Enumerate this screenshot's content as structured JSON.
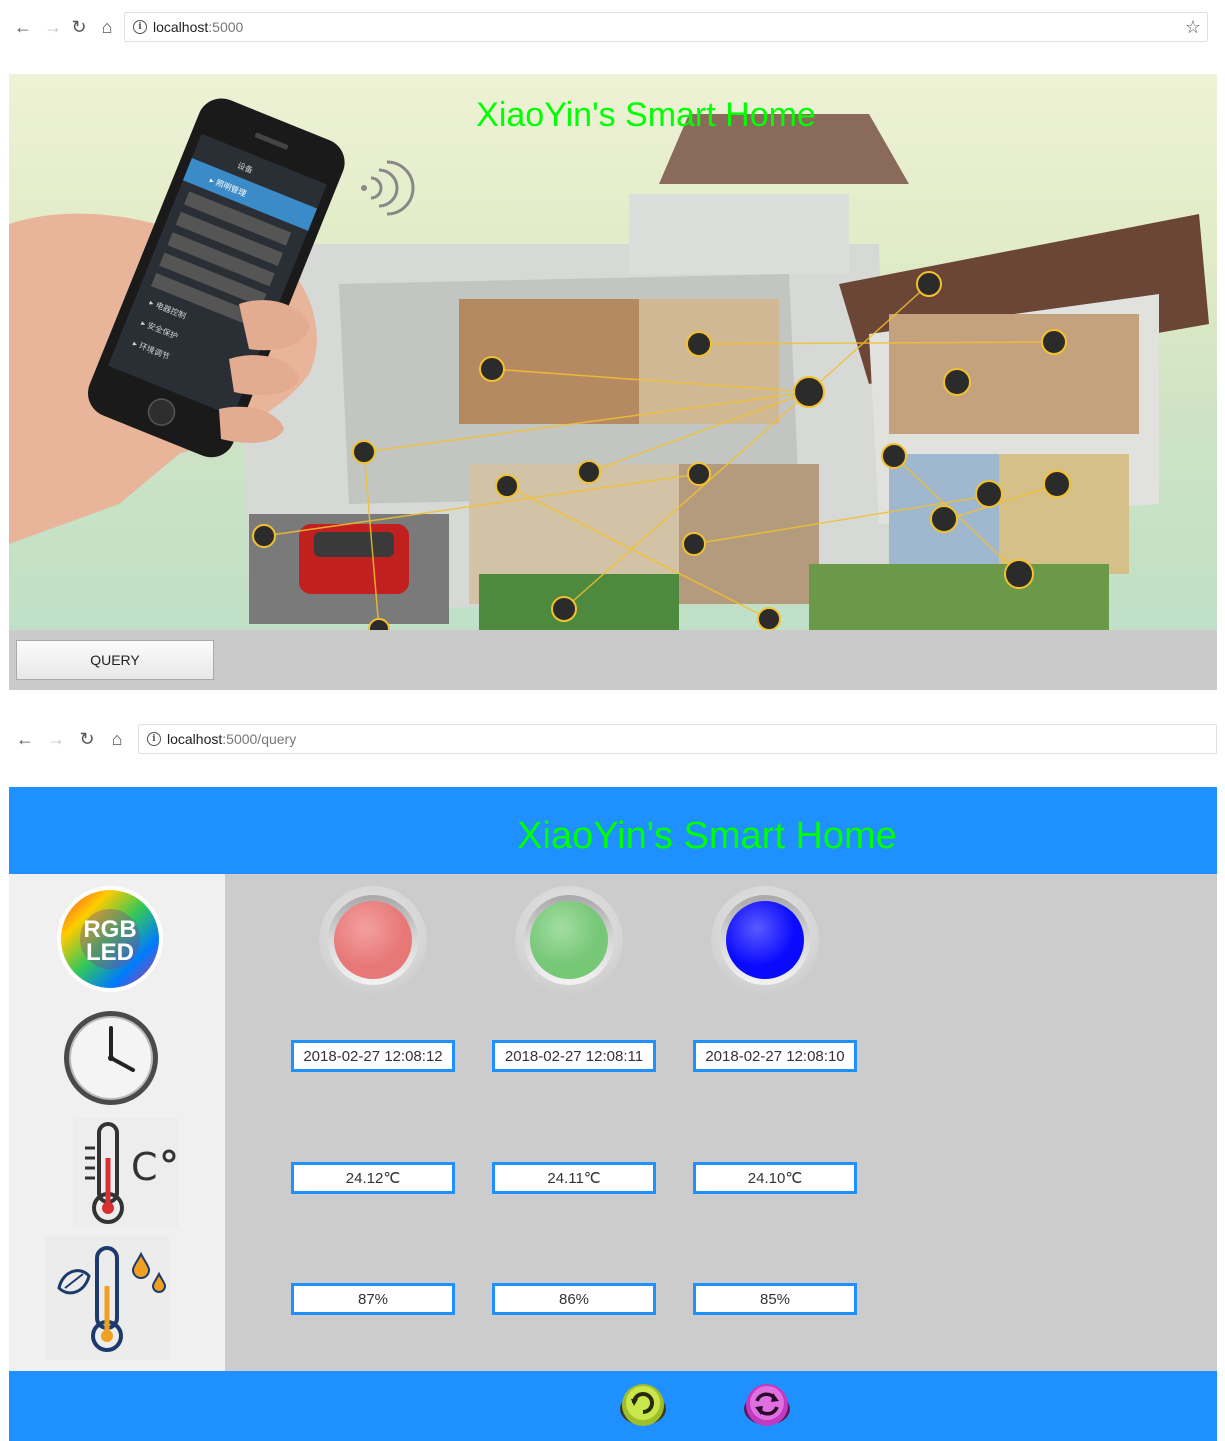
{
  "browser1": {
    "host": "localhost",
    "path": ":5000"
  },
  "browser2": {
    "host": "localhost",
    "path": ":5000/query"
  },
  "page1": {
    "title": "XiaoYin's Smart Home",
    "query_label": "QUERY",
    "phone_menu": [
      "照明管理",
      "电器控制",
      "安全保护",
      "环境调节"
    ],
    "phone_header": "设备"
  },
  "page2": {
    "title": "XiaoYin's Smart Home",
    "rgb_label_top": "RGB",
    "rgb_label_bottom": "LED",
    "leds": [
      {
        "color": "#e87878",
        "highlight": "#f4a0a0"
      },
      {
        "color": "#76c776",
        "highlight": "#a3dda3"
      },
      {
        "color": "#0a0aff",
        "highlight": "#5a5aff"
      }
    ],
    "timestamps": [
      "2018-02-27 12:08:12",
      "2018-02-27 12:08:11",
      "2018-02-27 12:08:10"
    ],
    "temperatures": [
      "24.12℃",
      "24.11℃",
      "24.10℃"
    ],
    "humidities": [
      "87%",
      "86%",
      "85%"
    ]
  }
}
